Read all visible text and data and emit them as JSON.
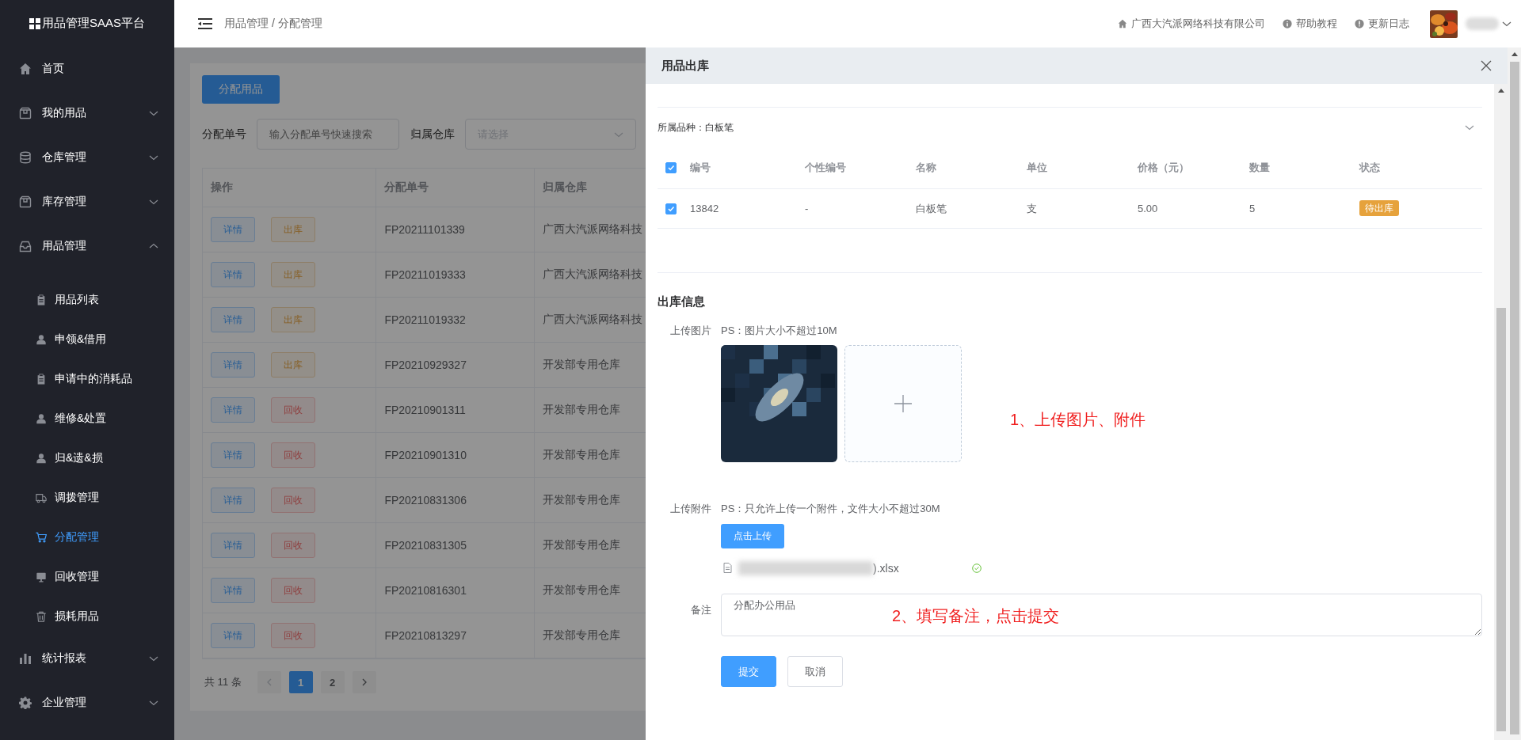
{
  "sidebar": {
    "logo": "用品管理SAAS平台",
    "items": [
      {
        "label": "首页",
        "kind": "home"
      },
      {
        "label": "我的用品",
        "kind": "box",
        "expanded": false
      },
      {
        "label": "仓库管理",
        "kind": "database",
        "expanded": false
      },
      {
        "label": "库存管理",
        "kind": "box",
        "expanded": false
      },
      {
        "label": "用品管理",
        "kind": "inbox",
        "expanded": true,
        "children": [
          {
            "label": "用品列表",
            "kind": "clipboard",
            "selected": false
          },
          {
            "label": "申领&借用",
            "kind": "user",
            "selected": false
          },
          {
            "label": "申请中的消耗品",
            "kind": "clipboard",
            "selected": false
          },
          {
            "label": "维修&处置",
            "kind": "user",
            "selected": false
          },
          {
            "label": "归&遗&损",
            "kind": "user",
            "selected": false
          },
          {
            "label": "调拨管理",
            "kind": "truck",
            "selected": false
          },
          {
            "label": "分配管理",
            "kind": "cart",
            "selected": true
          },
          {
            "label": "回收管理",
            "kind": "monitor",
            "selected": false
          },
          {
            "label": "损耗用品",
            "kind": "trash",
            "selected": false
          }
        ]
      },
      {
        "label": "统计报表",
        "kind": "chart",
        "expanded": false
      },
      {
        "label": "企业管理",
        "kind": "gear",
        "expanded": false
      }
    ]
  },
  "topbar": {
    "breadcrumb": "用品管理 / 分配管理",
    "links": [
      {
        "label": "广西大汽派网络科技有限公司",
        "kind": "home"
      },
      {
        "label": "帮助教程",
        "kind": "info"
      },
      {
        "label": "更新日志",
        "kind": "alert"
      }
    ]
  },
  "page": {
    "primary_button": "分配用品",
    "filters": [
      {
        "label": "分配单号",
        "kind": "input",
        "placeholder": "输入分配单号快速搜索"
      },
      {
        "label": "归属仓库",
        "kind": "select",
        "placeholder": "请选择"
      }
    ],
    "table": {
      "columns": [
        "操作",
        "分配单号",
        "归属仓库"
      ],
      "rows": [
        {
          "actions": [
            {
              "label": "详情",
              "kind": "detail"
            },
            {
              "label": "出库",
              "kind": "outbound"
            }
          ],
          "order_no": "FP20211101339",
          "warehouse": "广西大汽派网络科技"
        },
        {
          "actions": [
            {
              "label": "详情",
              "kind": "detail"
            },
            {
              "label": "出库",
              "kind": "outbound"
            }
          ],
          "order_no": "FP20211019333",
          "warehouse": "广西大汽派网络科技"
        },
        {
          "actions": [
            {
              "label": "详情",
              "kind": "detail"
            },
            {
              "label": "出库",
              "kind": "outbound"
            }
          ],
          "order_no": "FP20211019332",
          "warehouse": "广西大汽派网络科技"
        },
        {
          "actions": [
            {
              "label": "详情",
              "kind": "detail"
            },
            {
              "label": "出库",
              "kind": "outbound"
            }
          ],
          "order_no": "FP20210929327",
          "warehouse": "开发部专用仓库"
        },
        {
          "actions": [
            {
              "label": "详情",
              "kind": "detail"
            },
            {
              "label": "回收",
              "kind": "recycle"
            }
          ],
          "order_no": "FP20210901311",
          "warehouse": "开发部专用仓库"
        },
        {
          "actions": [
            {
              "label": "详情",
              "kind": "detail"
            },
            {
              "label": "回收",
              "kind": "recycle"
            }
          ],
          "order_no": "FP20210901310",
          "warehouse": "开发部专用仓库"
        },
        {
          "actions": [
            {
              "label": "详情",
              "kind": "detail"
            },
            {
              "label": "回收",
              "kind": "recycle"
            }
          ],
          "order_no": "FP20210831306",
          "warehouse": "开发部专用仓库"
        },
        {
          "actions": [
            {
              "label": "详情",
              "kind": "detail"
            },
            {
              "label": "回收",
              "kind": "recycle"
            }
          ],
          "order_no": "FP20210831305",
          "warehouse": "开发部专用仓库"
        },
        {
          "actions": [
            {
              "label": "详情",
              "kind": "detail"
            },
            {
              "label": "回收",
              "kind": "recycle"
            }
          ],
          "order_no": "FP20210816301",
          "warehouse": "开发部专用仓库"
        },
        {
          "actions": [
            {
              "label": "详情",
              "kind": "detail"
            },
            {
              "label": "回收",
              "kind": "recycle"
            }
          ],
          "order_no": "FP20210813297",
          "warehouse": "开发部专用仓库"
        }
      ]
    },
    "pagination": {
      "total": "共 11 条",
      "pages": [
        {
          "label": "1",
          "selected": true
        },
        {
          "label": "2",
          "selected": false
        }
      ]
    }
  },
  "drawer": {
    "title": "用品出库",
    "group": {
      "label": "所属品种：白板笔",
      "expanded": true
    },
    "items_table": {
      "all_checked": true,
      "columns": [
        "编号",
        "个性编号",
        "名称",
        "单位",
        "价格（元）",
        "数量",
        "状态"
      ],
      "rows": [
        {
          "checked": true,
          "cells": [
            "13842",
            "-",
            "白板笔",
            "支",
            "5.00",
            "5"
          ],
          "status": "待出库"
        }
      ]
    },
    "outbound_info": {
      "heading": "出库信息",
      "image_upload": {
        "label": "上传图片",
        "hint": "PS：图片大小不超过10M"
      },
      "attachment": {
        "label": "上传附件",
        "hint": "PS：只允许上传一个附件，文件大小不超过30M",
        "button": "点击上传",
        "files": [
          {
            "name": ").xlsx",
            "uploaded": true
          }
        ]
      },
      "remark": {
        "label": "备注",
        "value": "分配办公用品"
      },
      "buttons": [
        {
          "label": "提交",
          "kind": "primary"
        },
        {
          "label": "取消",
          "kind": "default"
        }
      ]
    }
  },
  "annotations": [
    {
      "text": "1、上传图片、附件"
    },
    {
      "text": "2、填写备注，点击提交"
    }
  ]
}
